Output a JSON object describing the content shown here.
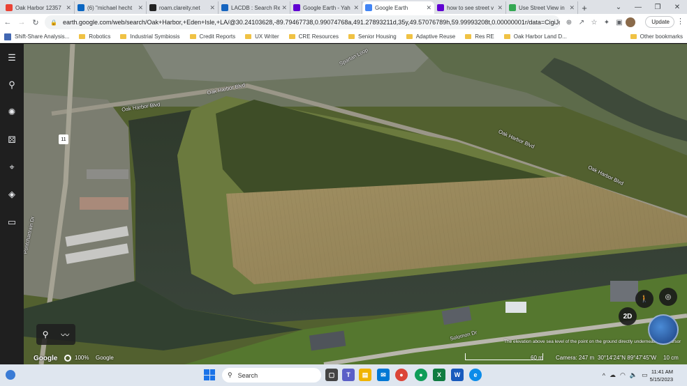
{
  "browser": {
    "tabs": [
      {
        "label": "Oak Harbor 12357",
        "icon": "gmail-icon",
        "color": "#ea4335"
      },
      {
        "label": "(6) \"michael hecht",
        "icon": "linkedin-icon",
        "color": "#0a66c2"
      },
      {
        "label": "roam.clareity.net",
        "icon": "clareity-icon",
        "color": "#222222"
      },
      {
        "label": "LACDB : Search Re",
        "icon": "lacdb-icon",
        "color": "#1565c0"
      },
      {
        "label": "Google Earth - Yah",
        "icon": "yahoo-icon",
        "color": "#6001d2"
      },
      {
        "label": "Google Earth",
        "icon": "google-earth-icon",
        "color": "#4285f4",
        "active": true
      },
      {
        "label": "how to see street v",
        "icon": "yahoo-icon",
        "color": "#6001d2"
      },
      {
        "label": "Use Street View in",
        "icon": "google-icon",
        "color": "#34a853"
      }
    ],
    "url": "earth.google.com/web/search/Oak+Harbor,+Eden+Isle,+LA/@30.24103628,-89.79467738,0.99074768a,491.27893211d,35y,49.57076789h,59.99993208t,0.00000001r/data=CigiJgokCdCU...",
    "update_label": "Update",
    "bookmarks": [
      {
        "label": "Shift-Share Analysis...",
        "icon": "grid-icon"
      },
      {
        "label": "Robotics",
        "icon": "folder-icon"
      },
      {
        "label": "Industrial Symbiosis",
        "icon": "folder-icon"
      },
      {
        "label": "Credit Reports",
        "icon": "folder-icon"
      },
      {
        "label": "UX Writer",
        "icon": "folder-icon"
      },
      {
        "label": "CRE Resources",
        "icon": "folder-icon"
      },
      {
        "label": "Senior Housing",
        "icon": "folder-icon"
      },
      {
        "label": "Adaptive Reuse",
        "icon": "folder-icon"
      },
      {
        "label": "Res RE",
        "icon": "folder-icon"
      },
      {
        "label": "Oak Harbor Land D...",
        "icon": "folder-icon"
      }
    ],
    "other_bookmarks": "Other bookmarks"
  },
  "map": {
    "road_labels": [
      "Spartan Loop",
      "Oak Harbor Blvd",
      "Oak Harbor Blvd",
      "Oak Harbor Blvd",
      "Oak Harbor Blvd",
      "Pontchartrain Dr",
      "Solomon Dr"
    ],
    "route_shield": "11",
    "google": "Google",
    "zoom": "100%",
    "attribution": "Google",
    "elevation_note": "The elevation above sea level of the point on the ground directly underneath your cursor",
    "scale": "60 m",
    "camera": "Camera: 247 m",
    "coordinates": "30°14'24\"N 89°47'45\"W",
    "scale_cm": "10 cm",
    "view_toggle": "2D"
  },
  "taskbar": {
    "search": "Search",
    "time": "11:41 AM",
    "date": "5/15/2023"
  }
}
